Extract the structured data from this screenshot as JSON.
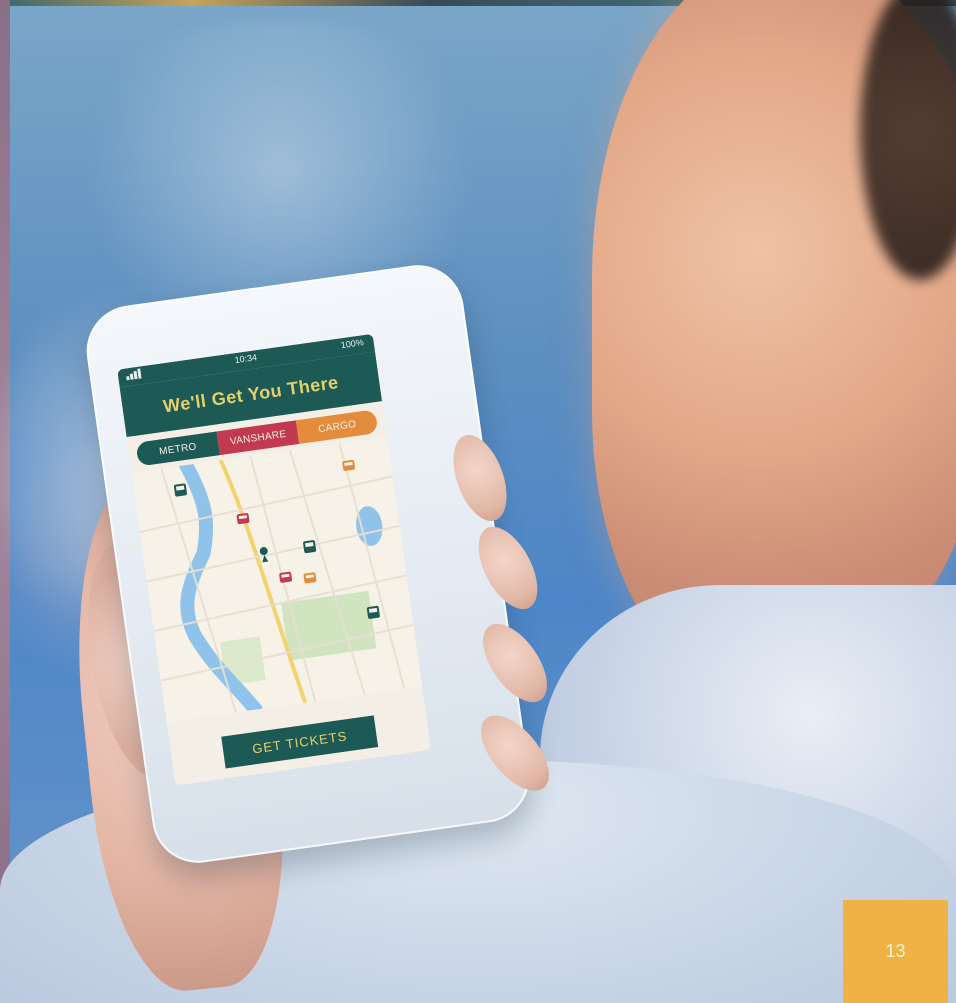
{
  "photo": {
    "subject": "person holding smartphone with map app"
  },
  "app": {
    "status": {
      "time": "10:34",
      "battery": "100%"
    },
    "title": "We'll Get You There",
    "tabs": [
      {
        "label": "METRO",
        "color": "#1E5A55"
      },
      {
        "label": "VANSHARE",
        "color": "#C23A50"
      },
      {
        "label": "CARGO",
        "color": "#E28C3C"
      }
    ],
    "button": {
      "label": "GET TICKETS"
    },
    "colors": {
      "primary": "#1E5A55",
      "accent": "#E6D06B",
      "vanshare": "#C23A50",
      "cargo": "#E28C3C"
    }
  },
  "page": {
    "number": "13",
    "badge_color": "#F0B244"
  }
}
